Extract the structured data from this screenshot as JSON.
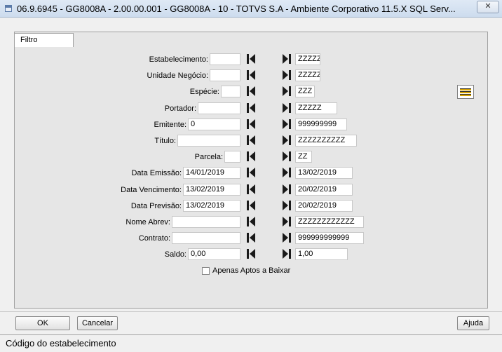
{
  "window": {
    "title": "06.9.6945 - GG8008A - 2.00.00.001 - GG8008A - 10 - TOTVS S.A - Ambiente Corporativo 11.5.X SQL Serv...",
    "close_icon": "close-icon",
    "app_icon": "window-app-icon"
  },
  "tabs": [
    {
      "label": "Filtro"
    }
  ],
  "form": {
    "rows": [
      {
        "label": "Estabelecimento:",
        "from": "",
        "to": "ZZZZZ"
      },
      {
        "label": "Unidade Negócio:",
        "from": "",
        "to": "ZZZZZ"
      },
      {
        "label": "Espécie:",
        "from": "",
        "to": "ZZZ"
      },
      {
        "label": "Portador:",
        "from": "",
        "to": "ZZZZZ"
      },
      {
        "label": "Emitente:",
        "from": "0",
        "to": "999999999"
      },
      {
        "label": "Título:",
        "from": "",
        "to": "ZZZZZZZZZZ"
      },
      {
        "label": "Parcela:",
        "from": "",
        "to": "ZZ"
      },
      {
        "label": "Data Emissão:",
        "from": "14/01/2019",
        "to": "13/02/2019"
      },
      {
        "label": "Data Vencimento:",
        "from": "13/02/2019",
        "to": "20/02/2019"
      },
      {
        "label": "Data Previsão:",
        "from": "13/02/2019",
        "to": "20/02/2019"
      },
      {
        "label": "Nome Abrev:",
        "from": "",
        "to": "ZZZZZZZZZZZZ"
      },
      {
        "label": "Contrato:",
        "from": "",
        "to": "999999999999"
      },
      {
        "label": "Saldo:",
        "from": "0,00",
        "to": "1,00"
      }
    ],
    "checkbox_label": "Apenas Aptos a Baixar",
    "checkbox_checked": false,
    "first_icon": "skip-to-first-icon",
    "last_icon": "skip-to-last-icon",
    "list_icon": "list-icon"
  },
  "buttons": {
    "ok": "OK",
    "cancel": "Cancelar",
    "help": "Ajuda"
  },
  "status": {
    "text": "Código do estabelecimento"
  },
  "colors": {
    "icon": "#1a1a1a",
    "list_icon_accent": "#d4a000"
  }
}
